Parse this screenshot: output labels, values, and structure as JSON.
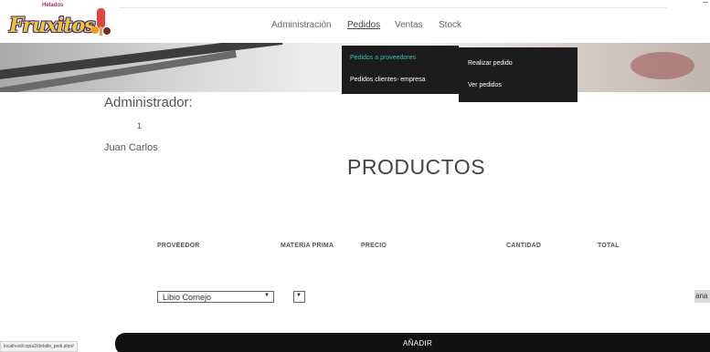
{
  "brand": {
    "small": "Helados",
    "word": "Fruxitos"
  },
  "nav": {
    "items": [
      {
        "label": "Administración",
        "active": false
      },
      {
        "label": "Pedidos",
        "active": true
      },
      {
        "label": "Ventas",
        "active": false
      },
      {
        "label": "Stock",
        "active": false
      }
    ]
  },
  "dropdown": {
    "level1": [
      "Pedidos a proveedores",
      "Pedidos clientes- empresa"
    ],
    "level2": [
      "Realizar pedido",
      "Ver pedidos"
    ]
  },
  "admin": {
    "title": "Administrador:",
    "number": "1",
    "name": "Juan Carlos"
  },
  "products": {
    "title": "PRODUCTOS",
    "headers": [
      "PROVEEDOR",
      "MATERIA PRIMA",
      "PRECIO",
      "CANTIDAD",
      "TOTAL"
    ],
    "proveedor_selected": "Libio Cornejo",
    "materia_selected": "",
    "cut_button": "ana"
  },
  "add_button": "AÑADIR",
  "status_url": "localhost/copia2/detalle_pedi.php#",
  "colors": {
    "menu_bg": "#1c1c1c",
    "menu_active": "#2ec4b6",
    "button_bg": "#111111"
  }
}
